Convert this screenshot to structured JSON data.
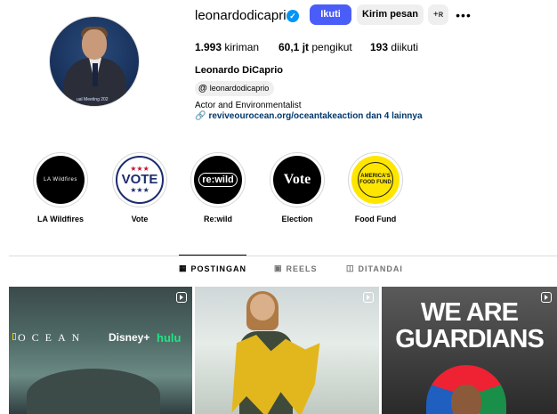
{
  "profile": {
    "username": "leonardodicaprio",
    "verified_glyph": "✓",
    "avatar_caption": "ual Meeting 202",
    "follow_label": "Ikuti",
    "message_label": "Kirim pesan",
    "add_icon": "+ʀ",
    "more_icon": "•••",
    "posts_count": "1.993",
    "posts_label": "kiriman",
    "followers_count": "60,1 jt",
    "followers_label": "pengikut",
    "following_count": "193",
    "following_label": "diikuti",
    "full_name": "Leonardo DiCaprio",
    "threads_handle": "leonardodicaprio",
    "bio": "Actor and Environmentalist",
    "link_text": "reviveourocean.org/oceantakeaction dan 4 lainnya"
  },
  "highlights": [
    {
      "label": "LA Wildfires",
      "cover": "LA Wildfires"
    },
    {
      "label": "Vote",
      "cover": "VOTE"
    },
    {
      "label": "Re:wild",
      "cover": "re:wild"
    },
    {
      "label": "Election",
      "cover": "Vote"
    },
    {
      "label": "Food Fund",
      "cover": "AMERICA'S FOOD FUND"
    }
  ],
  "tabs": [
    {
      "label": "POSTINGAN",
      "icon": "grid-icon",
      "active": true
    },
    {
      "label": "REELS",
      "icon": "reels-icon",
      "active": false
    },
    {
      "label": "DITANDAI",
      "icon": "tagged-icon",
      "active": false
    }
  ],
  "posts": [
    {
      "title": "OCEAN",
      "disney": "Disney+",
      "hulu": "hulu"
    },
    {
      "title": ""
    },
    {
      "title": "WE ARE GUARDIANS"
    }
  ],
  "colors": {
    "follow_button": "#4a5df9",
    "verified_badge": "#0095f6",
    "link": "#00376b",
    "food_fund": "#ffe600"
  }
}
